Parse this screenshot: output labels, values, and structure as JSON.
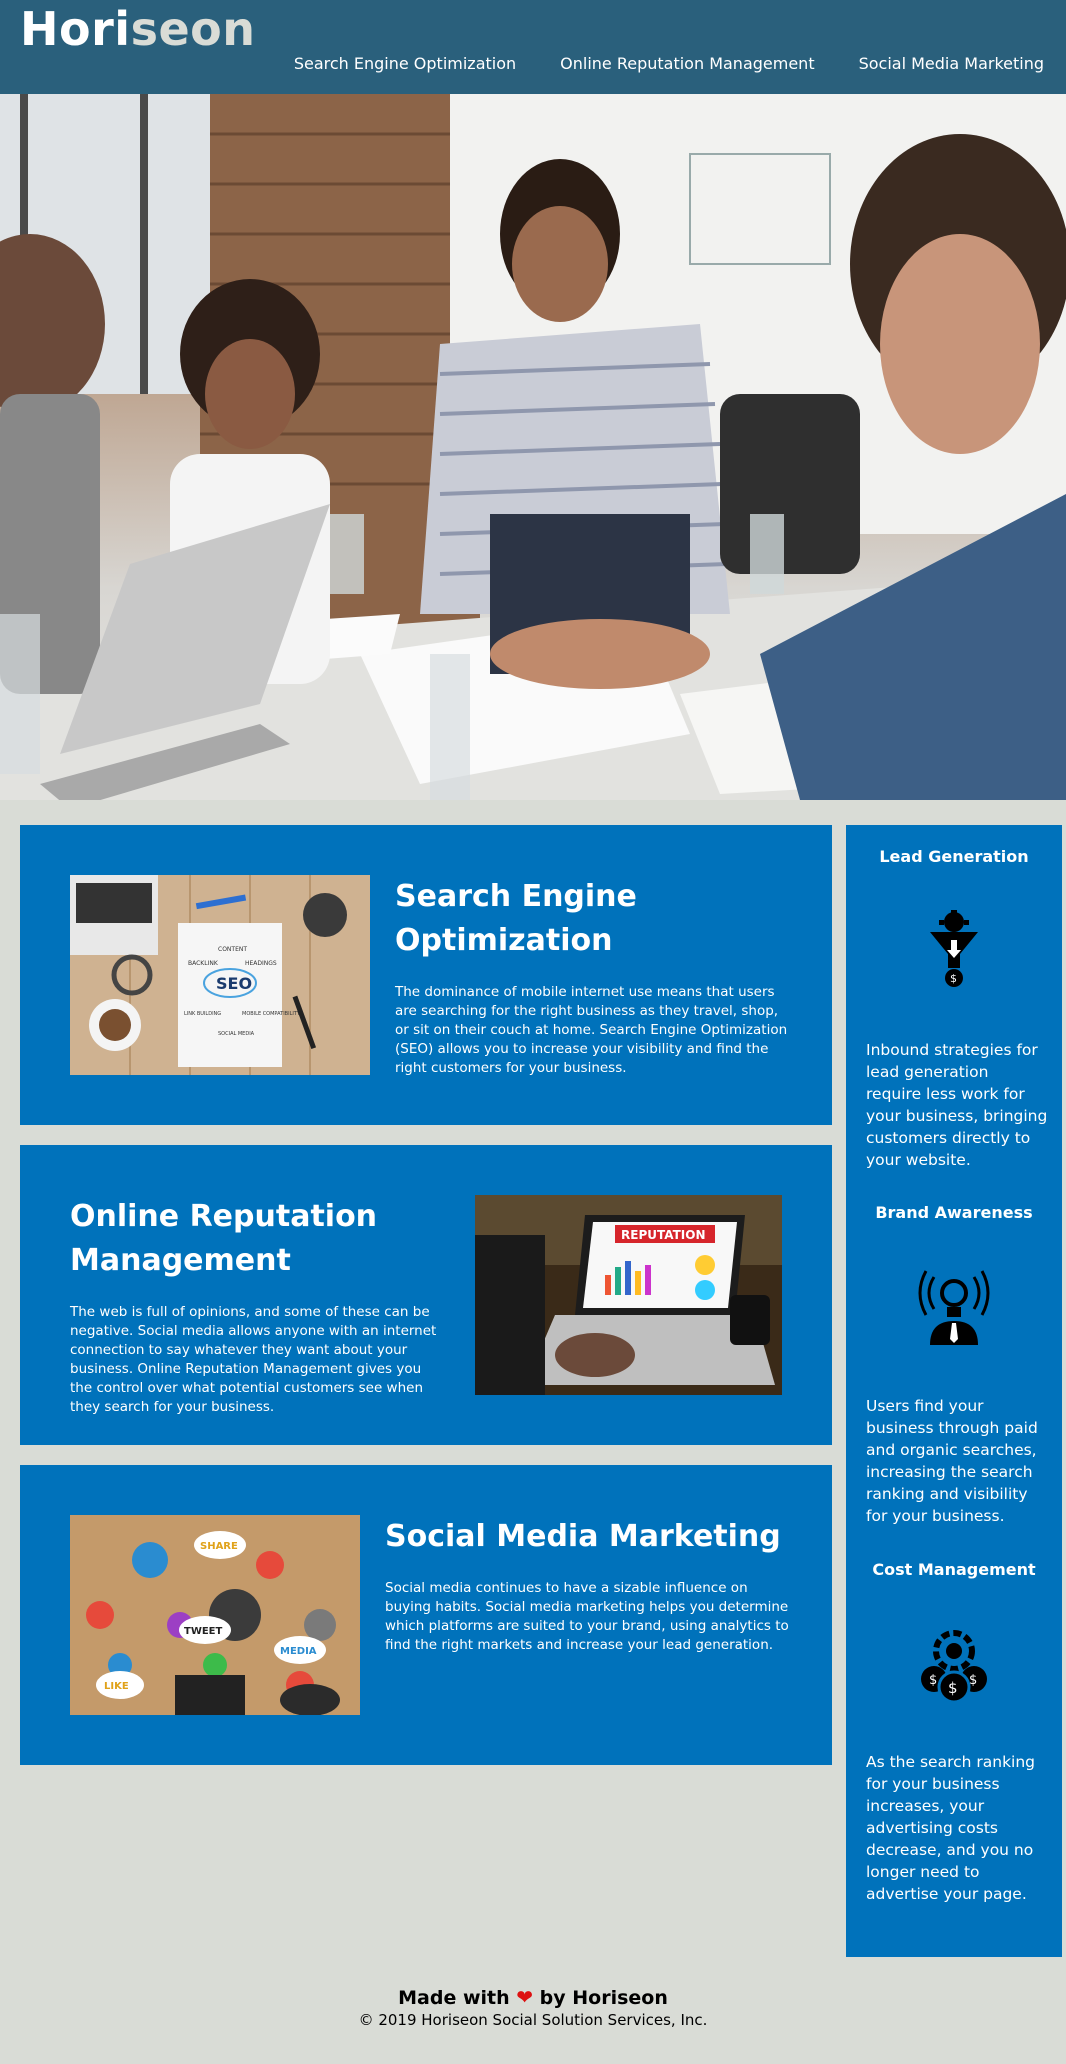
{
  "header": {
    "logo_main": "Hori",
    "logo_accent": "seon",
    "nav": [
      {
        "label": "Search Engine Optimization"
      },
      {
        "label": "Online Reputation Management"
      },
      {
        "label": "Social Media Marketing"
      }
    ]
  },
  "content": [
    {
      "title": "Search Engine Optimization",
      "text": "The dominance of mobile internet use means that users are searching for the right business as they travel, shop, or sit on their couch at home. Search Engine Optimization (SEO) allows you to increase your visibility and find the right customers for your business."
    },
    {
      "title": "Online Reputation Management",
      "text": "The web is full of opinions, and some of these can be negative. Social media allows anyone with an internet connection to say whatever they want about your business. Online Reputation Management gives you the control over what potential customers see when they search for your business."
    },
    {
      "title": "Social Media Marketing",
      "text": "Social media continues to have a sizable influence on buying habits. Social media marketing helps you determine which platforms are suited to your brand, using analytics to find the right markets and increase your lead generation."
    }
  ],
  "images": {
    "seo_words": [
      "CONTENT",
      "BACKLINK",
      "HEADINGS",
      "SEO",
      "LINK BUILDING",
      "MOBILE COMPATIBILITY",
      "SOCIAL MEDIA"
    ],
    "reputation_banner": "REPUTATION",
    "social_bubbles": [
      "SHARE",
      "TWEET",
      "LIKE",
      "MEDIA"
    ]
  },
  "sidebar": [
    {
      "title": "Lead Generation",
      "icon": "funnel-gear-icon",
      "text": "Inbound strategies for lead generation require less work for your business, bringing customers directly to your website."
    },
    {
      "title": "Brand Awareness",
      "icon": "broadcast-person-icon",
      "text": "Users find your business through paid and organic searches, increasing the search ranking and visibility for your business."
    },
    {
      "title": "Cost Management",
      "icon": "gear-coins-icon",
      "text": "As the search ranking for your business increases, your advertising costs decrease, and you no longer need to advertise your page."
    }
  ],
  "footer": {
    "made_with": "Made with",
    "by": "by Horiseon",
    "copyright": "© 2019 Horiseon Social Solution Services, Inc."
  },
  "colors": {
    "header_bg": "#2a607c",
    "card_bg": "#0072bb",
    "page_bg": "#d9dcd6"
  }
}
